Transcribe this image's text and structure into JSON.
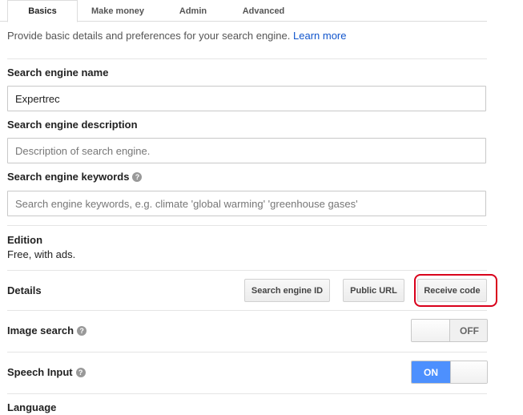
{
  "tabs": [
    {
      "label": "Basics"
    },
    {
      "label": "Make money"
    },
    {
      "label": "Admin"
    },
    {
      "label": "Advanced"
    }
  ],
  "intro": {
    "text": "Provide basic details and preferences for your search engine.",
    "link": "Learn more"
  },
  "name": {
    "label": "Search engine name",
    "value": "Expertrec"
  },
  "description": {
    "label": "Search engine description",
    "placeholder": "Description of search engine."
  },
  "keywords": {
    "label": "Search engine keywords",
    "placeholder": "Search engine keywords, e.g. climate 'global warming' 'greenhouse gases'"
  },
  "edition": {
    "label": "Edition",
    "value": "Free, with ads."
  },
  "details": {
    "label": "Details",
    "buttons": {
      "search_engine_id": "Search engine ID",
      "public_url": "Public URL",
      "receive_code": "Receive code"
    }
  },
  "image_search": {
    "label": "Image search",
    "state": "OFF"
  },
  "speech_input": {
    "label": "Speech Input",
    "state": "ON"
  },
  "language": {
    "label": "Language"
  },
  "colors": {
    "link": "#1155cc",
    "toggle_on": "#4d90fe",
    "highlight": "#d9001b"
  }
}
